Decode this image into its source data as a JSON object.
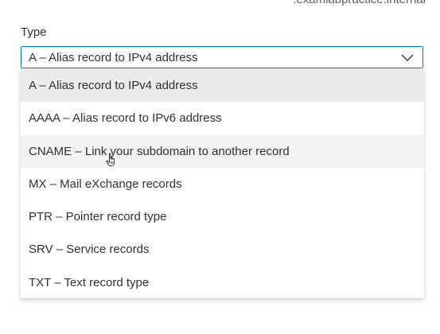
{
  "header": {
    "zone_suffix": ".examlabpractice.internal"
  },
  "type_field": {
    "label": "Type",
    "selected_value": "A – Alias record to IPv4 address",
    "options": [
      {
        "label": "A – Alias record to IPv4 address"
      },
      {
        "label": "AAAA – Alias record to IPv6 address"
      },
      {
        "label": "CNAME – Link your subdomain to another record"
      },
      {
        "label": "MX – Mail eXchange records"
      },
      {
        "label": "PTR – Pointer record type"
      },
      {
        "label": "SRV – Service records"
      },
      {
        "label": "TXT – Text record type"
      }
    ]
  },
  "icons": {
    "chevron": "chevron-down-icon",
    "cursor": "hand-pointer-cursor-icon"
  },
  "colors": {
    "focus_border": "#0078d4",
    "selected_bg": "#edebe9",
    "hover_bg": "#f3f2f1",
    "text": "#323130"
  }
}
